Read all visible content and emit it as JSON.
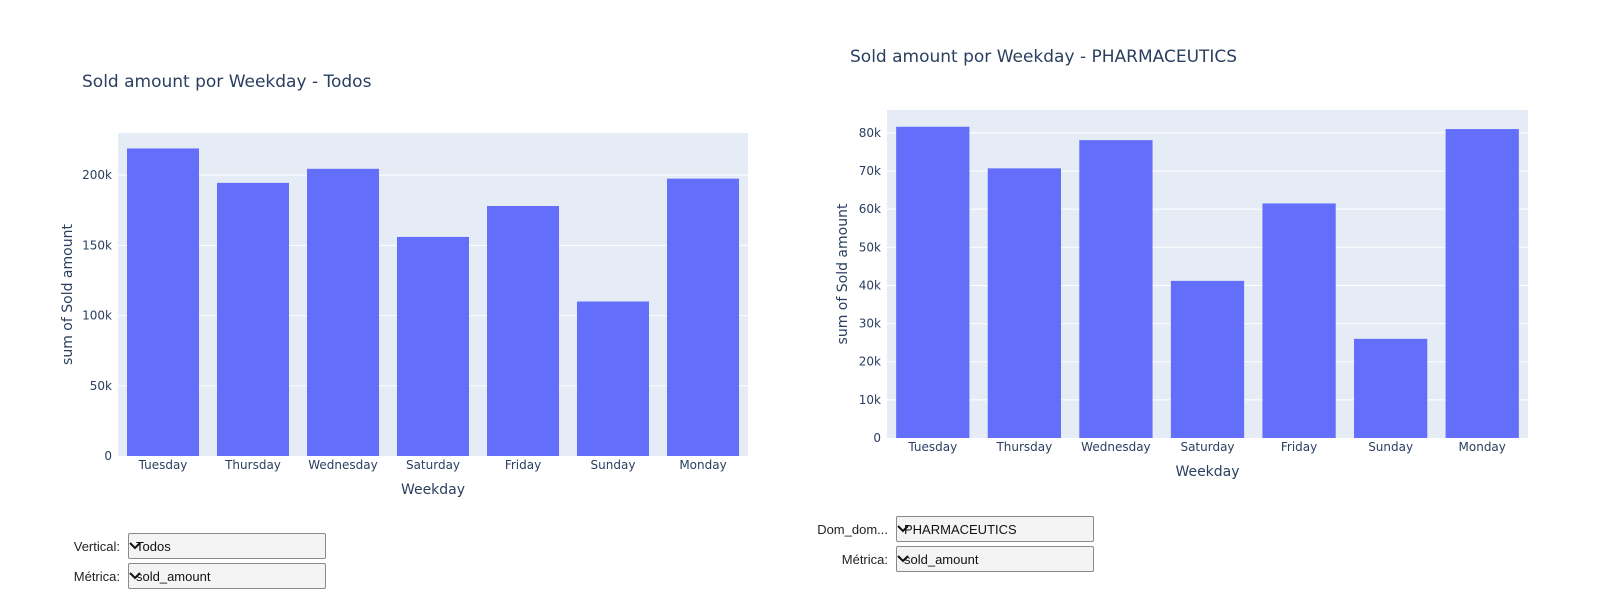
{
  "charts": {
    "left": {
      "chart_data": {
        "type": "bar",
        "title": "Sold amount por Weekday - Todos",
        "xlabel": "Weekday",
        "ylabel": "sum of Sold amount",
        "categories": [
          "Tuesday",
          "Thursday",
          "Wednesday",
          "Saturday",
          "Friday",
          "Sunday",
          "Monday"
        ],
        "values": [
          219000,
          194500,
          204500,
          156000,
          178000,
          110000,
          197500
        ],
        "ylim": [
          0,
          230000
        ],
        "yticks": [
          0,
          50000,
          100000,
          150000,
          200000
        ],
        "ytick_labels": [
          "0",
          "50k",
          "100k",
          "150k",
          "200k"
        ],
        "color": "#636efa",
        "plot_bg": "#e5ecf6",
        "grid": true
      },
      "controls": [
        {
          "label": "Vertical:",
          "value": "Todos"
        },
        {
          "label": "Métrica:",
          "value": "sold_amount"
        }
      ]
    },
    "right": {
      "chart_data": {
        "type": "bar",
        "title": "Sold amount por Weekday - PHARMACEUTICS",
        "xlabel": "Weekday",
        "ylabel": "sum of Sold amount",
        "categories": [
          "Tuesday",
          "Thursday",
          "Wednesday",
          "Saturday",
          "Friday",
          "Sunday",
          "Monday"
        ],
        "values": [
          81600,
          70700,
          78100,
          41200,
          61500,
          26000,
          81000
        ],
        "ylim": [
          0,
          86000
        ],
        "yticks": [
          0,
          10000,
          20000,
          30000,
          40000,
          50000,
          60000,
          70000,
          80000
        ],
        "ytick_labels": [
          "0",
          "10k",
          "20k",
          "30k",
          "40k",
          "50k",
          "60k",
          "70k",
          "80k"
        ],
        "color": "#636efa",
        "plot_bg": "#e5ecf6",
        "grid": true
      },
      "controls": [
        {
          "label": "Dom_dom...",
          "value": "PHARMACEUTICS"
        },
        {
          "label": "Métrica:",
          "value": "sold_amount"
        }
      ]
    }
  }
}
